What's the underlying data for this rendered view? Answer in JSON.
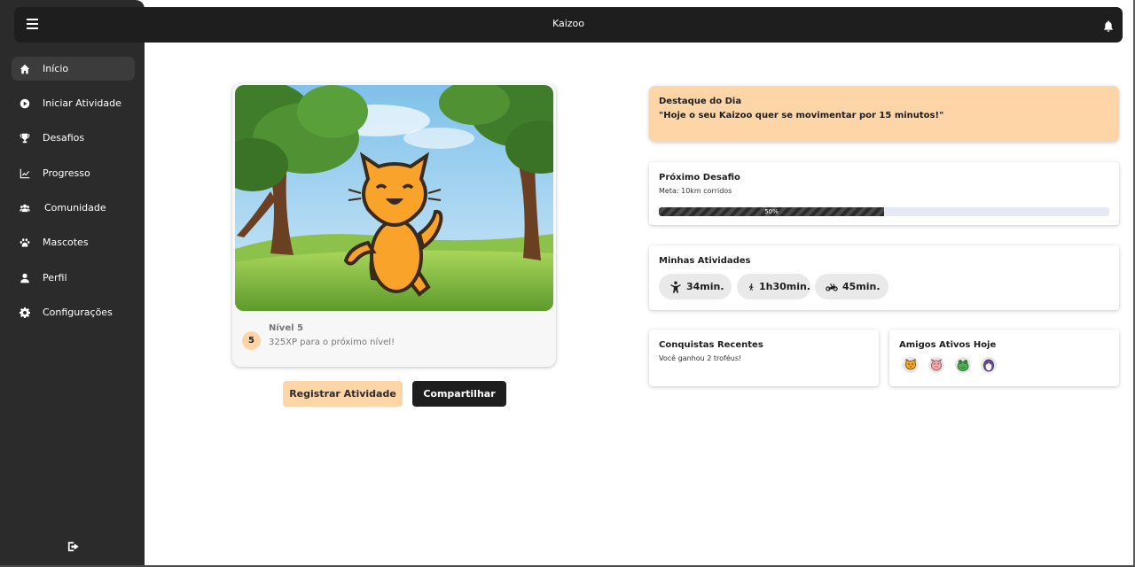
{
  "app": {
    "title": "Kaizoo"
  },
  "sidebar": {
    "items": [
      {
        "label": "Início",
        "icon": "home-icon",
        "active": true
      },
      {
        "label": "Iniciar Atividade",
        "icon": "play-circle-icon"
      },
      {
        "label": "Desafios",
        "icon": "trophy-icon"
      },
      {
        "label": "Progresso",
        "icon": "chart-line-icon"
      },
      {
        "label": "Comunidade",
        "icon": "users-icon"
      },
      {
        "label": "Mascotes",
        "icon": "paw-icon"
      },
      {
        "label": "Perfil",
        "icon": "user-icon"
      },
      {
        "label": "Configurações",
        "icon": "gear-icon"
      }
    ],
    "logout_icon": "logout-icon"
  },
  "pet": {
    "level_number": "5",
    "level_title": "Nível 5",
    "xp_text": "325XP para o próximo nível!"
  },
  "actions": {
    "register": "Registrar Atividade",
    "share": "Compartilhar"
  },
  "highlight": {
    "title": "Destaque do Dia",
    "quote": "\"Hoje o seu Kaizoo quer se movimentar por 15 minutos!\""
  },
  "challenge": {
    "title": "Próximo Desafio",
    "goal": "Meta: 10km corridos",
    "progress_label": "50%",
    "progress_value": 0.5
  },
  "activities": {
    "title": "Minhas Atividades",
    "items": [
      {
        "icon": "person-icon",
        "label": "34min."
      },
      {
        "icon": "walking-icon",
        "label": "1h30min."
      },
      {
        "icon": "bicycle-icon",
        "label": "45min."
      }
    ]
  },
  "achievements": {
    "title": "Conquistas Recentes",
    "text": "Você ganhou 2 troféus!"
  },
  "friends": {
    "title": "Amigos Ativos Hoje",
    "avatars": [
      "cat-avatar",
      "pig-avatar",
      "frog-avatar",
      "penguin-avatar"
    ]
  },
  "colors": {
    "accent": "#fdd5a6",
    "dark": "#1e1e1e",
    "sidebar": "#2b2b2b",
    "progress_track": "#e6e8f3"
  }
}
